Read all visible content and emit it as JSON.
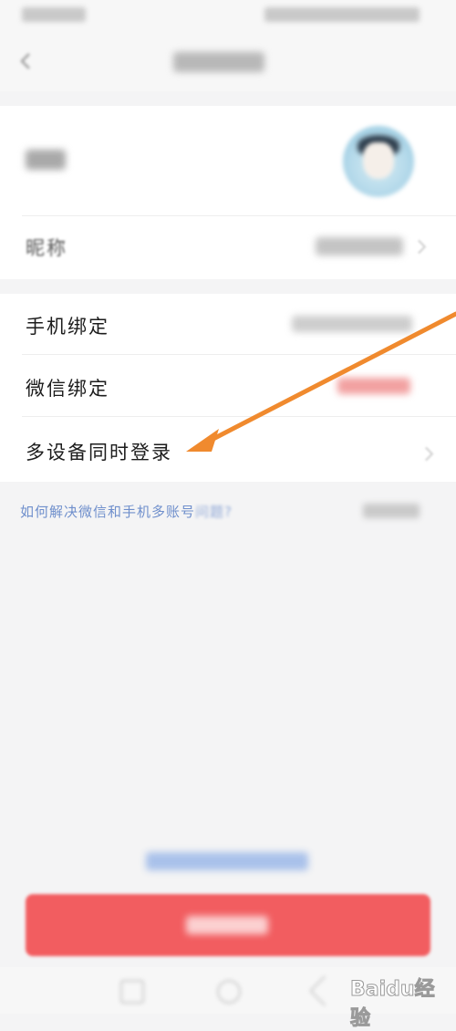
{
  "screen": {
    "background_color": "#f4f4f5",
    "accent_color": "#f25d60",
    "link_color": "#6f8fcc",
    "annotation_color": "#f08a2e"
  },
  "profile": {
    "nickname_label": "昵称"
  },
  "bindings": {
    "rows": [
      {
        "label": "手机绑定"
      },
      {
        "label": "微信绑定"
      },
      {
        "label": "多设备同时登录"
      }
    ]
  },
  "help": {
    "link_text": "如何解决微信和手机多账号",
    "link_text_faded": "问题?"
  },
  "watermark": {
    "text": "Baidu经验"
  }
}
